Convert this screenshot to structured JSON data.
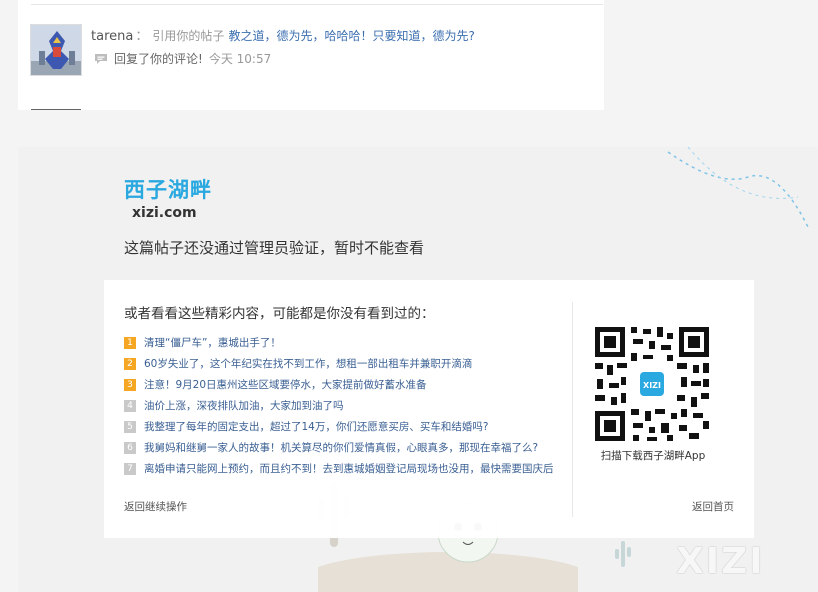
{
  "comment": {
    "user": "tarena",
    "separator": "：",
    "quote_prefix": "引用你的帖子",
    "quote_text": "教之道，德为先，哈哈哈！只要知道，德为先?",
    "reply_text": "回复了你的评论!",
    "time": "今天 10:57"
  },
  "panel": {
    "logo_cn": "西子湖畔",
    "logo_en": "xizi.com",
    "notice": "这篇帖子还没通过管理员验证，暂时不能查看"
  },
  "card": {
    "sub_title": "或者看看这些精彩内容，可能都是你没有看到过的：",
    "items": [
      {
        "num": "1",
        "hot": true,
        "text": "清理“僵尸车”，惠城出手了！"
      },
      {
        "num": "2",
        "hot": true,
        "text": "60岁失业了，这个年纪实在找不到工作，想租一部出租车并兼职开滴滴"
      },
      {
        "num": "3",
        "hot": true,
        "text": "注意！9月20日惠州这些区域要停水，大家提前做好蓄水准备"
      },
      {
        "num": "4",
        "hot": false,
        "text": "油价上涨，深夜排队加油，大家加到油了吗"
      },
      {
        "num": "5",
        "hot": false,
        "text": "我整理了每年的固定支出，超过了14万，你们还愿意买房、买车和结婚吗?"
      },
      {
        "num": "6",
        "hot": false,
        "text": "我舅妈和继舅一家人的故事！机关算尽的你们爱情真假，心眼真多，那现在幸福了么?"
      },
      {
        "num": "7",
        "hot": false,
        "text": "离婚申请只能网上预约，而且约不到！去到惠城婚姻登记局现场也没用，最快需要国庆后"
      }
    ],
    "back_operation": "返回继续操作",
    "qr_caption": "扫描下载西子湖畔App",
    "qr_center_label": "XIZI",
    "back_home": "返回首页"
  },
  "watermark": "XIZI",
  "colors": {
    "accent": "#2aa8e0",
    "link": "#3a5f93",
    "hot_badge": "#f5a623",
    "normal_badge": "#c9c9c9"
  },
  "icons": {
    "comment": "speech-bubble-icon",
    "qr": "qr-code-icon"
  }
}
